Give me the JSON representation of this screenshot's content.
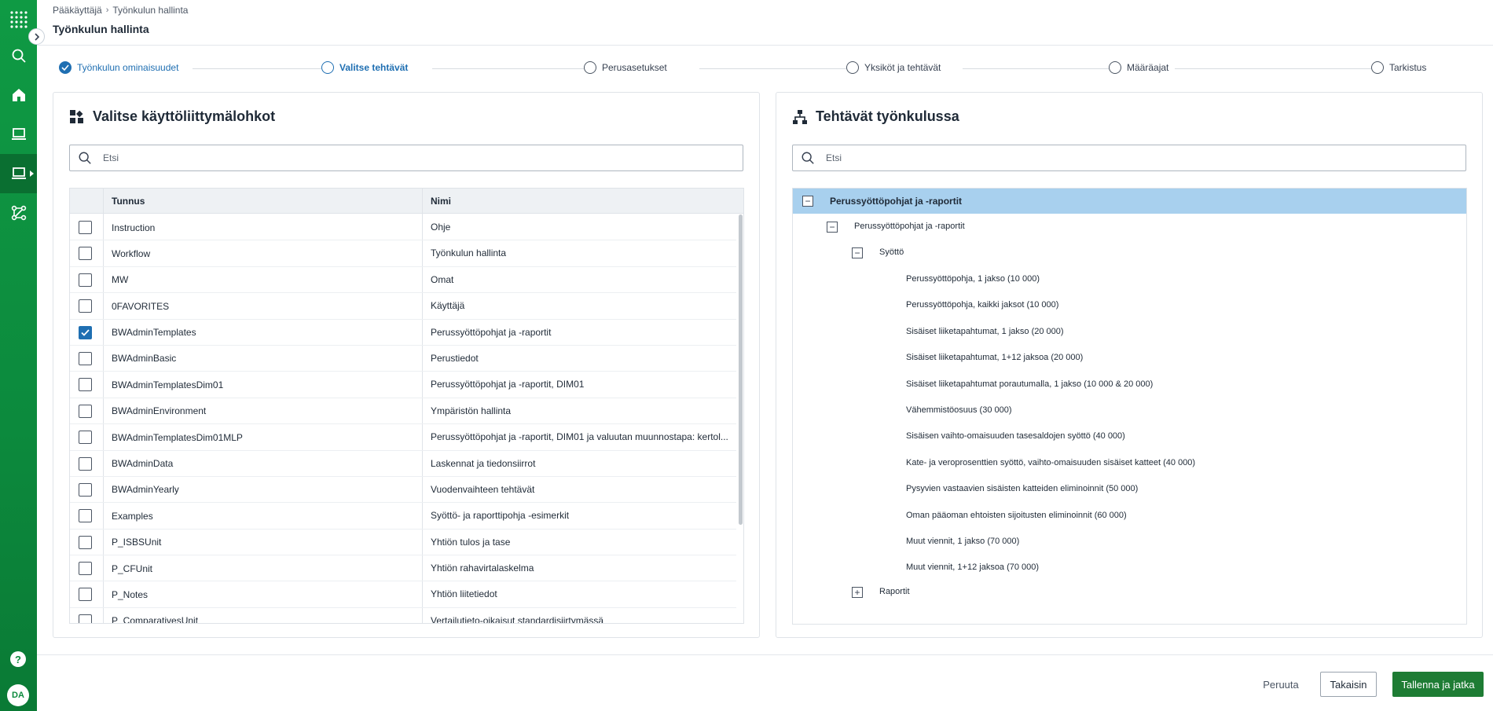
{
  "breadcrumb": {
    "parent": "Pääkäyttäjä",
    "separator": "›",
    "current": "Työnkulun hallinta"
  },
  "page_title": "Työnkulun hallinta",
  "stepper": [
    {
      "label": "Työnkulun ominaisuudet",
      "state": "done"
    },
    {
      "label": "Valitse tehtävät",
      "state": "current"
    },
    {
      "label": "Perusasetukset",
      "state": "pending"
    },
    {
      "label": "Yksiköt ja tehtävät",
      "state": "pending"
    },
    {
      "label": "Määräajat",
      "state": "pending"
    },
    {
      "label": "Tarkistus",
      "state": "pending"
    }
  ],
  "left_panel": {
    "title": "Valitse käyttöliittymälohkot",
    "icon": "widgets-icon",
    "search_placeholder": "Etsi",
    "columns": [
      "Tunnus",
      "Nimi"
    ],
    "rows": [
      {
        "id": "Instruction",
        "name": "Ohje",
        "checked": false
      },
      {
        "id": "Workflow",
        "name": "Työnkulun hallinta",
        "checked": false
      },
      {
        "id": "MW",
        "name": "Omat",
        "checked": false
      },
      {
        "id": "0FAVORITES",
        "name": "Käyttäjä",
        "checked": false
      },
      {
        "id": "BWAdminTemplates",
        "name": "Perussyöttöpohjat ja -raportit",
        "checked": true
      },
      {
        "id": "BWAdminBasic",
        "name": "Perustiedot",
        "checked": false
      },
      {
        "id": "BWAdminTemplatesDim01",
        "name": "Perussyöttöpohjat ja -raportit, DIM01",
        "checked": false
      },
      {
        "id": "BWAdminEnvironment",
        "name": "Ympäristön hallinta",
        "checked": false
      },
      {
        "id": "BWAdminTemplatesDim01MLP",
        "name": "Perussyöttöpohjat ja -raportit, DIM01 ja valuutan muunnostapa: kertol...",
        "checked": false
      },
      {
        "id": "BWAdminData",
        "name": "Laskennat ja tiedonsiirrot",
        "checked": false
      },
      {
        "id": "BWAdminYearly",
        "name": "Vuodenvaihteen tehtävät",
        "checked": false
      },
      {
        "id": "Examples",
        "name": "Syöttö- ja raporttipohja -esimerkit",
        "checked": false
      },
      {
        "id": "P_ISBSUnit",
        "name": "Yhtiön tulos ja tase",
        "checked": false
      },
      {
        "id": "P_CFUnit",
        "name": "Yhtiön rahavirtalaskelma",
        "checked": false
      },
      {
        "id": "P_Notes",
        "name": "Yhtiön liitetiedot",
        "checked": false
      },
      {
        "id": "P_ComparativesUnit",
        "name": "Vertailutieto-oikaisut standardisiirtymässä",
        "checked": false
      }
    ]
  },
  "right_panel": {
    "title": "Tehtävät työnkulussa",
    "icon": "hierarchy-icon",
    "search_placeholder": "Etsi",
    "tree": {
      "root": "Perussyöttöpohjat ja -raportit",
      "child": "Perussyöttöpohjat ja -raportit",
      "group_input": "Syöttö",
      "leaves": [
        "Perussyöttöpohja, 1 jakso (10 000)",
        "Perussyöttöpohja, kaikki jaksot (10 000)",
        "Sisäiset liiketapahtumat, 1 jakso (20 000)",
        "Sisäiset liiketapahtumat, 1+12 jaksoa (20 000)",
        "Sisäiset liiketapahtumat porautumalla, 1 jakso (10 000 & 20 000)",
        "Vähemmistöosuus (30 000)",
        "Sisäisen vaihto-omaisuuden tasesaldojen syöttö (40 000)",
        "Kate- ja veroprosenttien syöttö, vaihto-omaisuuden sisäiset katteet (40 000)",
        "Pysyvien vastaavien sisäisten katteiden eliminoinnit (50 000)",
        "Oman pääoman ehtoisten sijoitusten eliminoinnit (60 000)",
        "Muut viennit, 1 jakso (70 000)",
        "Muut viennit, 1+12 jaksoa (70 000)"
      ],
      "group_reports": "Raportit"
    }
  },
  "sidebar": {
    "icons": [
      "apps-grid-icon",
      "search-icon",
      "home-icon",
      "laptop-icon",
      "laptop-active-icon",
      "workflow-icon",
      "help-icon"
    ],
    "help_label": "?",
    "avatar_initials": "DA"
  },
  "footer": {
    "cancel_label": "Peruuta",
    "back_label": "Takaisin",
    "save_label": "Tallenna ja jatka"
  },
  "colors": {
    "brand_green": "#0c8a3d",
    "accent_blue": "#1f6fb2",
    "selected_row": "#a8d0ee",
    "primary_button": "#1e7c34"
  }
}
